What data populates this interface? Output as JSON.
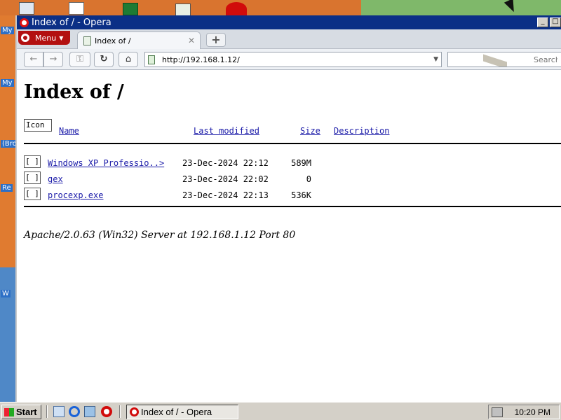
{
  "desktop": {
    "labels": [
      "My",
      "My",
      "(Bro",
      "Re",
      "W"
    ]
  },
  "window": {
    "title": "Index of / - Opera",
    "menu_label": "Menu",
    "tab_title": "Index of /",
    "tab_close": "✕",
    "new_tab": "+",
    "address": "http://192.168.1.12/",
    "search_placeholder": "Search"
  },
  "page": {
    "heading": "Index of /",
    "columns": {
      "icon": "Icon",
      "name": "Name",
      "last_modified": "Last modified",
      "size": "Size",
      "description": "Description"
    },
    "rows": [
      {
        "icon": "[ ]",
        "name": "Windows XP Professio..>",
        "modified": "23-Dec-2024 22:12",
        "size": "589M"
      },
      {
        "icon": "[ ]",
        "name": "gex",
        "modified": "23-Dec-2024 22:02",
        "size": "0"
      },
      {
        "icon": "[ ]",
        "name": "procexp.exe",
        "modified": "23-Dec-2024 22:13",
        "size": "536K"
      }
    ],
    "footer": "Apache/2.0.63 (Win32) Server at 192.168.1.12 Port 80"
  },
  "taskbar": {
    "start_label": "Start",
    "task_label": "Index of / - Opera",
    "clock": "10:20 PM"
  },
  "colors": {
    "titlebar": "#0b2f86",
    "link": "#1a1aa8",
    "opera_red": "#d10b0b"
  }
}
